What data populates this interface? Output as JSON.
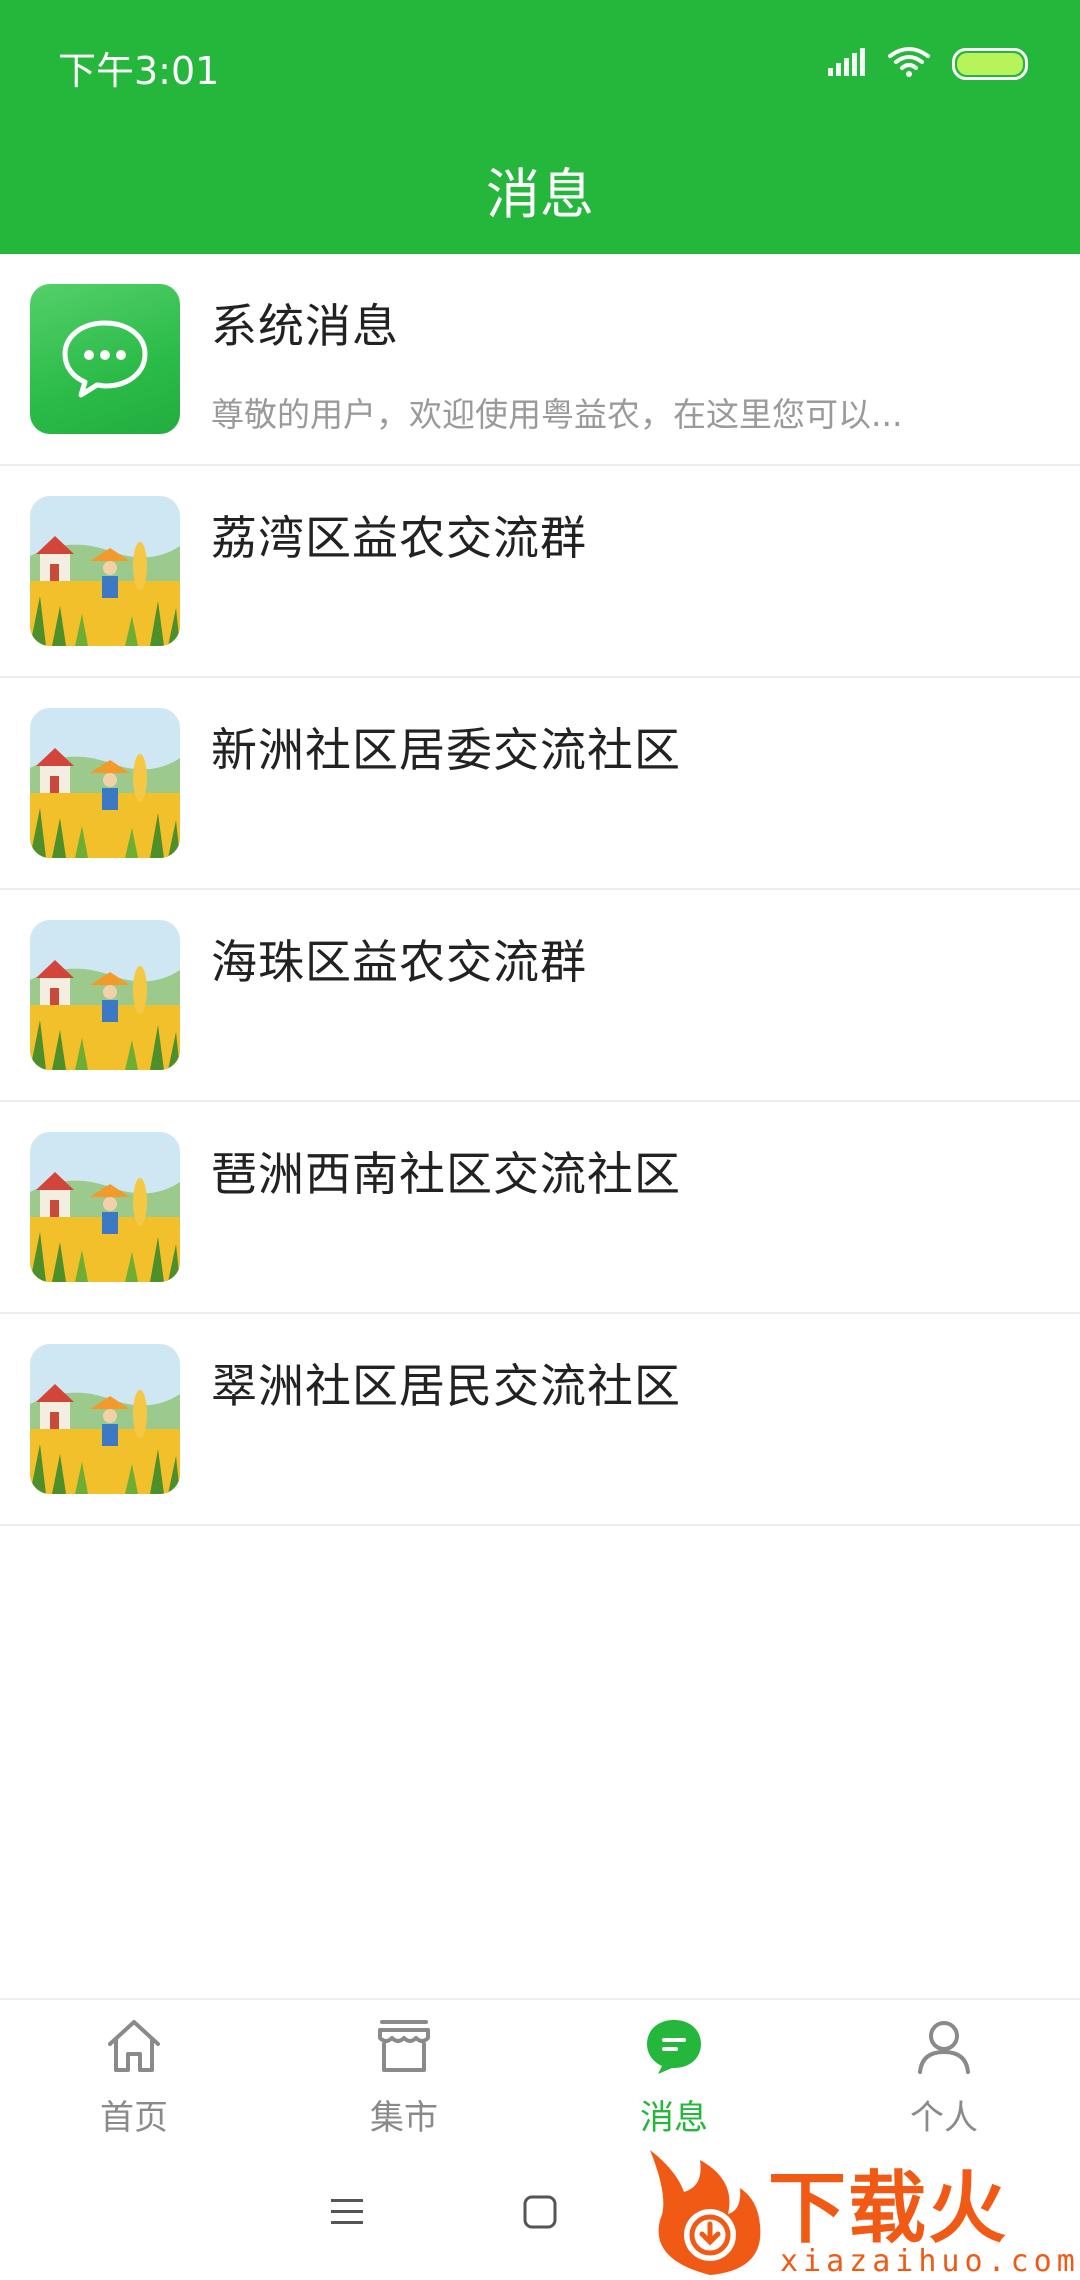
{
  "status_bar": {
    "time": "下午3:01"
  },
  "header": {
    "title": "消息"
  },
  "conversations": [
    {
      "title": "系统消息",
      "preview": "尊敬的用户，欢迎使用粤益农，在这里您可以...",
      "avatar": "chat-bubble-icon"
    },
    {
      "title": "荔湾区益农交流群",
      "preview": "",
      "avatar": "farm-scarecrow-image"
    },
    {
      "title": "新洲社区居委交流社区",
      "preview": "",
      "avatar": "farm-scarecrow-image"
    },
    {
      "title": "海珠区益农交流群",
      "preview": "",
      "avatar": "farm-scarecrow-image"
    },
    {
      "title": "琶洲西南社区交流社区",
      "preview": "",
      "avatar": "farm-scarecrow-image"
    },
    {
      "title": "翠洲社区居民交流社区",
      "preview": "",
      "avatar": "farm-scarecrow-image"
    }
  ],
  "bottom_nav": [
    {
      "label": "首页",
      "icon": "home-icon",
      "active": false
    },
    {
      "label": "集市",
      "icon": "market-icon",
      "active": false
    },
    {
      "label": "消息",
      "icon": "message-icon",
      "active": true
    },
    {
      "label": "个人",
      "icon": "person-icon",
      "active": false
    }
  ],
  "watermark": {
    "brand": "下载火",
    "url": "xiazaihuo.com"
  },
  "colors": {
    "brand_green": "#25b73b",
    "text": "#222222",
    "muted": "#9a9a9a",
    "watermark_orange": "#f05a14"
  }
}
